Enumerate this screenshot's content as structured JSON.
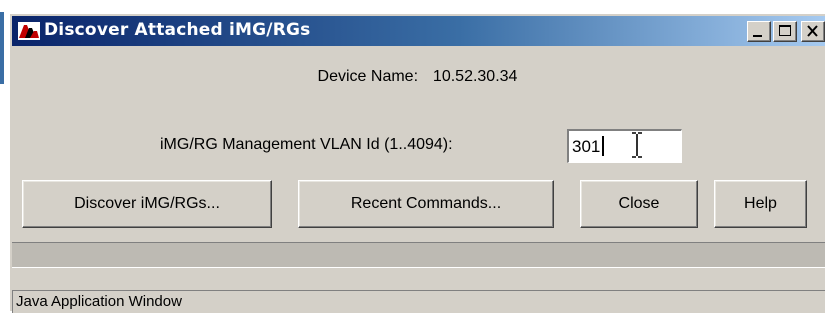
{
  "window": {
    "title": "Discover Attached iMG/RGs",
    "icon": "java-app-icon",
    "controls": [
      "minimize-icon",
      "maximize-icon",
      "close-icon"
    ]
  },
  "device": {
    "label": "Device Name:",
    "value": "10.52.30.34"
  },
  "vlan": {
    "label": "iMG/RG Management VLAN Id (1..4094):",
    "value": "301"
  },
  "buttons": {
    "discover": "Discover iMG/RGs...",
    "recent": "Recent Commands...",
    "close": "Close",
    "help": "Help"
  },
  "status": {
    "text": "Java Application Window"
  },
  "colors": {
    "titlebar_start": "#0a246a",
    "titlebar_end": "#a6caf0",
    "face": "#d4d0c8"
  }
}
